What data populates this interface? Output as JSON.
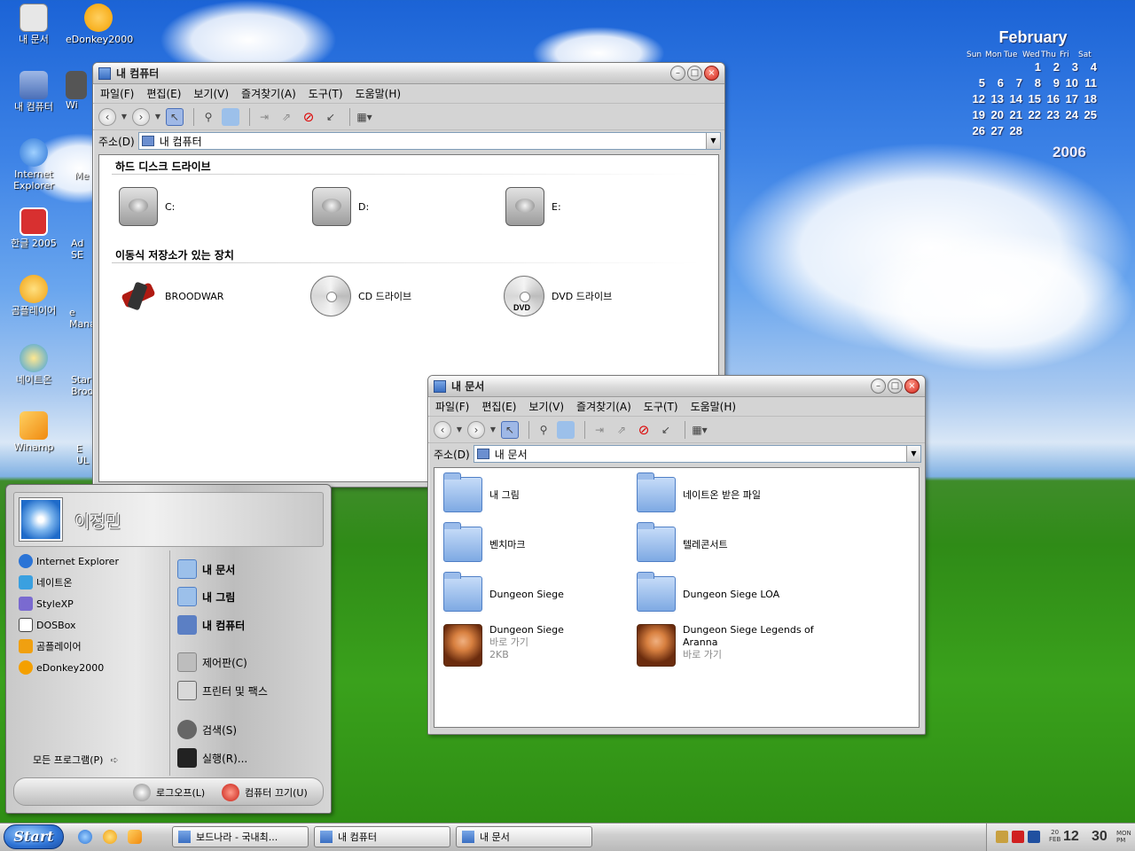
{
  "desktop": {
    "icons": [
      {
        "label": "내 문서",
        "color": "#e7e7e7"
      },
      {
        "label": "eDonkey2000",
        "color": "#f4a000"
      },
      {
        "label": "내 컴퓨터",
        "color": "#5b7fc4"
      },
      {
        "label": "Internet Explorer",
        "color": "#2b74d6"
      },
      {
        "label": "한글 2005",
        "color": "#d83030"
      },
      {
        "label": "곰플레이어",
        "color": "#f0a010"
      },
      {
        "label": "네이트온",
        "color": "#3aa0e0"
      },
      {
        "label": "Winamp",
        "color": "#f08a10"
      }
    ],
    "partial_icons": [
      "Wi",
      "Me",
      "Ad SE",
      "e Mana",
      "Star Broo",
      "E UL"
    ]
  },
  "calendar": {
    "month": "February",
    "year": "2006",
    "weekdays": [
      "Sun",
      "Mon",
      "Tue",
      "Wed",
      "Thu",
      "Fri",
      "Sat"
    ],
    "days": [
      "",
      "",
      "",
      "1",
      "2",
      "3",
      "4",
      "5",
      "6",
      "7",
      "8",
      "9",
      "10",
      "11",
      "12",
      "13",
      "14",
      "15",
      "16",
      "17",
      "18",
      "19",
      "20",
      "21",
      "22",
      "23",
      "24",
      "25",
      "26",
      "27",
      "28"
    ],
    "today": "20"
  },
  "window_computer": {
    "title": "내 컴퓨터",
    "menu": [
      "파일(F)",
      "편집(E)",
      "보기(V)",
      "즐겨찾기(A)",
      "도구(T)",
      "도움말(H)"
    ],
    "address_label": "주소(D)",
    "address_value": "내 컴퓨터",
    "group_hdd": "하드 디스크 드라이브",
    "group_removable": "이동식 저장소가 있는 장치",
    "drives": [
      "C:",
      "D:",
      "E:"
    ],
    "removable": [
      "BROODWAR",
      "CD 드라이브",
      "DVD 드라이브"
    ],
    "dvd_logo": "DVD"
  },
  "window_docs": {
    "title": "내 문서",
    "menu": [
      "파일(F)",
      "편집(E)",
      "보기(V)",
      "즐겨찾기(A)",
      "도구(T)",
      "도움말(H)"
    ],
    "address_label": "주소(D)",
    "address_value": "내 문서",
    "items": [
      {
        "name": "내 그림"
      },
      {
        "name": "네이트온 받은 파일"
      },
      {
        "name": "벤치마크"
      },
      {
        "name": "텔레콘서트"
      },
      {
        "name": "Dungeon Siege"
      },
      {
        "name": "Dungeon Siege LOA"
      }
    ],
    "shortcuts": [
      {
        "name": "Dungeon Siege",
        "type": "바로 가기",
        "size": "2KB"
      },
      {
        "name": "Dungeon Siege Legends of",
        "name2": "Aranna",
        "type": "바로 가기"
      }
    ]
  },
  "start_menu": {
    "user": "이정민",
    "left_items": [
      {
        "label": "Internet Explorer",
        "color": "#2b74d6"
      },
      {
        "label": "네이트온",
        "color": "#3aa0e0"
      },
      {
        "label": "StyleXP",
        "color": "#7a6ad0"
      },
      {
        "label": "DOSBox",
        "color": "#444444"
      },
      {
        "label": "곰플레이어",
        "color": "#f0a010"
      },
      {
        "label": "eDonkey2000",
        "color": "#f4a000"
      }
    ],
    "right_items": [
      "내 문서",
      "내 그림",
      "내 컴퓨터",
      "제어판(C)",
      "프린터 및 팩스",
      "검색(S)",
      "실행(R)..."
    ],
    "all_programs": "모든 프로그램(P)",
    "logoff": "로그오프(L)",
    "shutdown": "컴퓨터 끄기(U)"
  },
  "taskbar": {
    "start_label": "Start",
    "tasks": [
      "보드나라 - 국내최...",
      "내 컴퓨터",
      "내 문서"
    ],
    "clock": {
      "day": "20",
      "month": "FEB",
      "hour": "12",
      "minute": "30",
      "weekday": "MON",
      "ampm": "PM"
    }
  }
}
